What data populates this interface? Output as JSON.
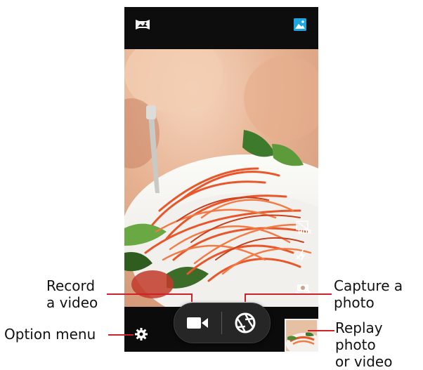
{
  "callouts": {
    "record_video": [
      "Record",
      "a video"
    ],
    "capture_photo": [
      "Capture a",
      "photo"
    ],
    "option_menu": "Option menu",
    "replay": [
      "Replay photo",
      "or video"
    ]
  },
  "viewfinder_controls": {
    "hdr_label": "HDR"
  },
  "icons": {
    "top_left": "panorama-icon",
    "top_right": "gallery-icon",
    "hdr": "hdr-icon",
    "flash": "flash-off-icon",
    "switch_camera": "switch-camera-icon",
    "record": "video-camera-icon",
    "shutter": "shutter-icon",
    "settings": "gear-icon",
    "thumbnail": "last-photo-thumbnail"
  },
  "colors": {
    "callout_line": "#d0202a",
    "gallery_accent": "#1ea6e0"
  }
}
